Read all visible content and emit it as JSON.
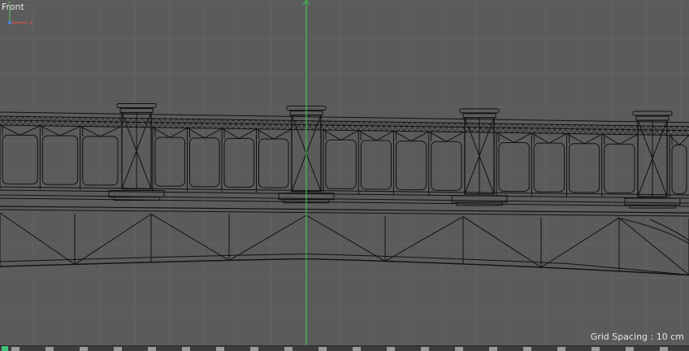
{
  "viewport": {
    "view_name": "Front",
    "grid_spacing_text": "Grid Spacing : 10 cm",
    "colors": {
      "background": "#5b5b5b",
      "grid_line": "#636363",
      "wire": "#111111",
      "y_axis": "#36c24a",
      "axis_x_gizmo": "#d9534f",
      "axis_y_gizmo": "#5cb85c",
      "axis_z_gizmo": "#4a7bd1"
    },
    "axis_gizmo": {
      "x_label": "X",
      "y_label": "Y"
    }
  }
}
